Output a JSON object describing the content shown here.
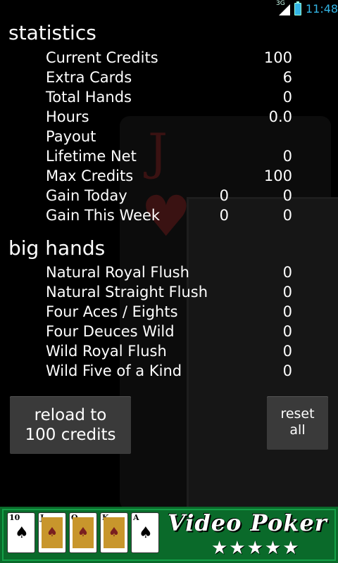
{
  "status_bar": {
    "network": "3G",
    "time": "11:48"
  },
  "statistics": {
    "title": "statistics",
    "rows": [
      {
        "label": "Current Credits",
        "v1": "",
        "v2": "100"
      },
      {
        "label": "Extra Cards",
        "v1": "",
        "v2": "6"
      },
      {
        "label": "Total Hands",
        "v1": "",
        "v2": "0"
      },
      {
        "label": "Hours",
        "v1": "",
        "v2": "0.0"
      },
      {
        "label": "Payout",
        "v1": "",
        "v2": ""
      },
      {
        "label": "Lifetime Net",
        "v1": "",
        "v2": "0"
      },
      {
        "label": "Max Credits",
        "v1": "",
        "v2": "100"
      },
      {
        "label": "Gain Today",
        "v1": "0",
        "v2": "0"
      },
      {
        "label": "Gain This Week",
        "v1": "0",
        "v2": "0"
      }
    ]
  },
  "big_hands": {
    "title": "big hands",
    "rows": [
      {
        "label": "Natural Royal Flush",
        "value": "0"
      },
      {
        "label": "Natural Straight Flush",
        "value": "0"
      },
      {
        "label": "Four Aces / Eights",
        "value": "0"
      },
      {
        "label": "Four Deuces Wild",
        "value": "0"
      },
      {
        "label": "Wild Royal Flush",
        "value": "0"
      },
      {
        "label": "Wild Five of a Kind",
        "value": "0"
      }
    ]
  },
  "buttons": {
    "reload_line1": "reload to",
    "reload_line2": "100 credits",
    "reset_line1": "reset",
    "reset_line2": "all"
  },
  "banner": {
    "cards": [
      {
        "rank": "10",
        "suit": "♠"
      },
      {
        "rank": "J",
        "suit": "♠"
      },
      {
        "rank": "Q",
        "suit": "♠"
      },
      {
        "rank": "K",
        "suit": "♠"
      },
      {
        "rank": "A",
        "suit": "♠"
      }
    ],
    "title": "Video Poker",
    "stars": "★★★★★"
  },
  "colors": {
    "accent": "#33b5e5",
    "banner_green": "#0a6a2a",
    "button": "#3a3a3a"
  }
}
